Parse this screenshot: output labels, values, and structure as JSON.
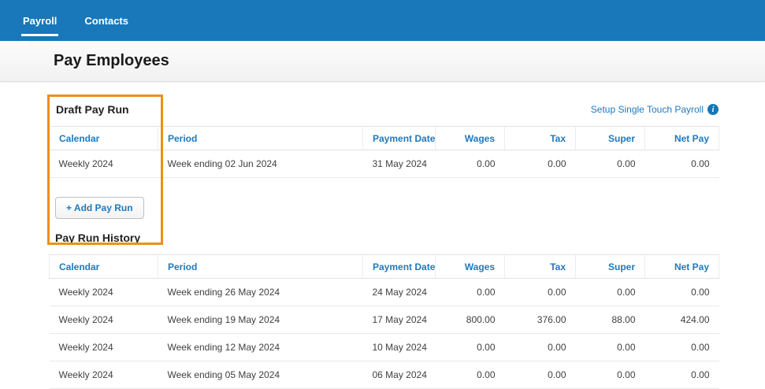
{
  "nav": {
    "tabs": [
      {
        "label": "Payroll",
        "active": true
      },
      {
        "label": "Contacts",
        "active": false
      }
    ]
  },
  "page": {
    "title": "Pay Employees"
  },
  "draft_section": {
    "heading": "Draft Pay Run",
    "setup_link_label": "Setup Single Touch Payroll",
    "add_pay_run_label": "+ Add Pay Run"
  },
  "history_section": {
    "heading": "Pay Run History"
  },
  "tables": {
    "headers": [
      "Calendar",
      "Period",
      "Payment Date",
      "Wages",
      "Tax",
      "Super",
      "Net Pay"
    ],
    "draft_rows": [
      [
        "Weekly 2024",
        "Week ending 02 Jun 2024",
        "31 May 2024",
        "0.00",
        "0.00",
        "0.00",
        "0.00"
      ]
    ],
    "history_rows": [
      [
        "Weekly 2024",
        "Week ending 26 May 2024",
        "24 May 2024",
        "0.00",
        "0.00",
        "0.00",
        "0.00"
      ],
      [
        "Weekly 2024",
        "Week ending 19 May 2024",
        "17 May 2024",
        "800.00",
        "376.00",
        "88.00",
        "424.00"
      ],
      [
        "Weekly 2024",
        "Week ending 12 May 2024",
        "10 May 2024",
        "0.00",
        "0.00",
        "0.00",
        "0.00"
      ],
      [
        "Weekly 2024",
        "Week ending 05 May 2024",
        "06 May 2024",
        "0.00",
        "0.00",
        "0.00",
        "0.00"
      ]
    ]
  },
  "colors": {
    "nav_blue": "#1878b9",
    "link_blue": "#1f79bd",
    "annotation_orange": "#ef8e1b"
  }
}
